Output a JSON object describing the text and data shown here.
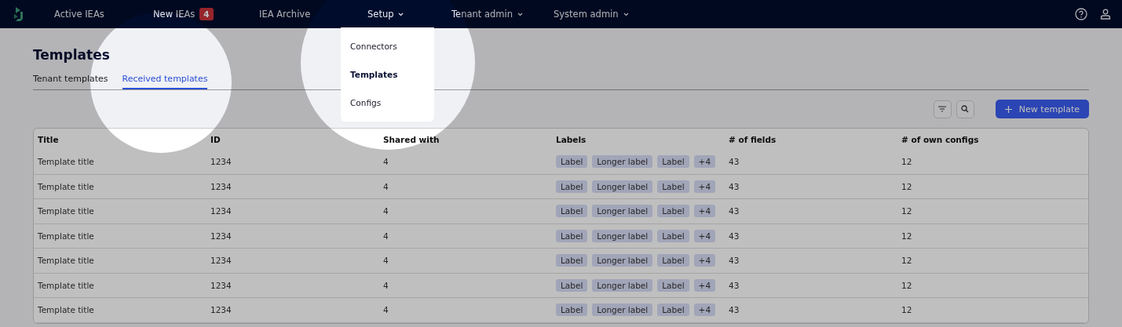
{
  "nav": {
    "items": [
      {
        "label": "Active IEAs",
        "kind": "link"
      },
      {
        "label": "New IEAs",
        "kind": "link",
        "badge": "4"
      },
      {
        "label": "IEA Archive",
        "kind": "link"
      },
      {
        "label": "Setup",
        "kind": "menu",
        "expanded": true
      },
      {
        "label": "Tenant admin",
        "kind": "menu",
        "expanded": false
      },
      {
        "label": "System admin",
        "kind": "menu",
        "expanded": false
      }
    ],
    "dropdown": [
      {
        "label": "Connectors",
        "selected": false
      },
      {
        "label": "Templates",
        "selected": true
      },
      {
        "label": "Configs",
        "selected": false
      }
    ]
  },
  "page": {
    "title": "Templates",
    "tabs": [
      {
        "label": "Tenant templates",
        "selected": false
      },
      {
        "label": "Received templates",
        "selected": true
      }
    ],
    "new_button": "New template"
  },
  "table": {
    "columns": [
      "Title",
      "ID",
      "Shared with",
      "Labels",
      "# of fields",
      "# of own configs"
    ],
    "rows": [
      {
        "title": "Template title",
        "id": "1234",
        "shared_with": "4",
        "labels": [
          "Label",
          "Longer label",
          "Label"
        ],
        "more": "+4",
        "fields": "43",
        "own_configs": "12"
      },
      {
        "title": "Template title",
        "id": "1234",
        "shared_with": "4",
        "labels": [
          "Label",
          "Longer label",
          "Label"
        ],
        "more": "+4",
        "fields": "43",
        "own_configs": "12"
      },
      {
        "title": "Template title",
        "id": "1234",
        "shared_with": "4",
        "labels": [
          "Label",
          "Longer label",
          "Label"
        ],
        "more": "+4",
        "fields": "43",
        "own_configs": "12"
      },
      {
        "title": "Template title",
        "id": "1234",
        "shared_with": "4",
        "labels": [
          "Label",
          "Longer label",
          "Label"
        ],
        "more": "+4",
        "fields": "43",
        "own_configs": "12"
      },
      {
        "title": "Template title",
        "id": "1234",
        "shared_with": "4",
        "labels": [
          "Label",
          "Longer label",
          "Label"
        ],
        "more": "+4",
        "fields": "43",
        "own_configs": "12"
      },
      {
        "title": "Template title",
        "id": "1234",
        "shared_with": "4",
        "labels": [
          "Label",
          "Longer label",
          "Label"
        ],
        "more": "+4",
        "fields": "43",
        "own_configs": "12"
      },
      {
        "title": "Template title",
        "id": "1234",
        "shared_with": "4",
        "labels": [
          "Label",
          "Longer label",
          "Label"
        ],
        "more": "+4",
        "fields": "43",
        "own_configs": "12"
      }
    ]
  }
}
